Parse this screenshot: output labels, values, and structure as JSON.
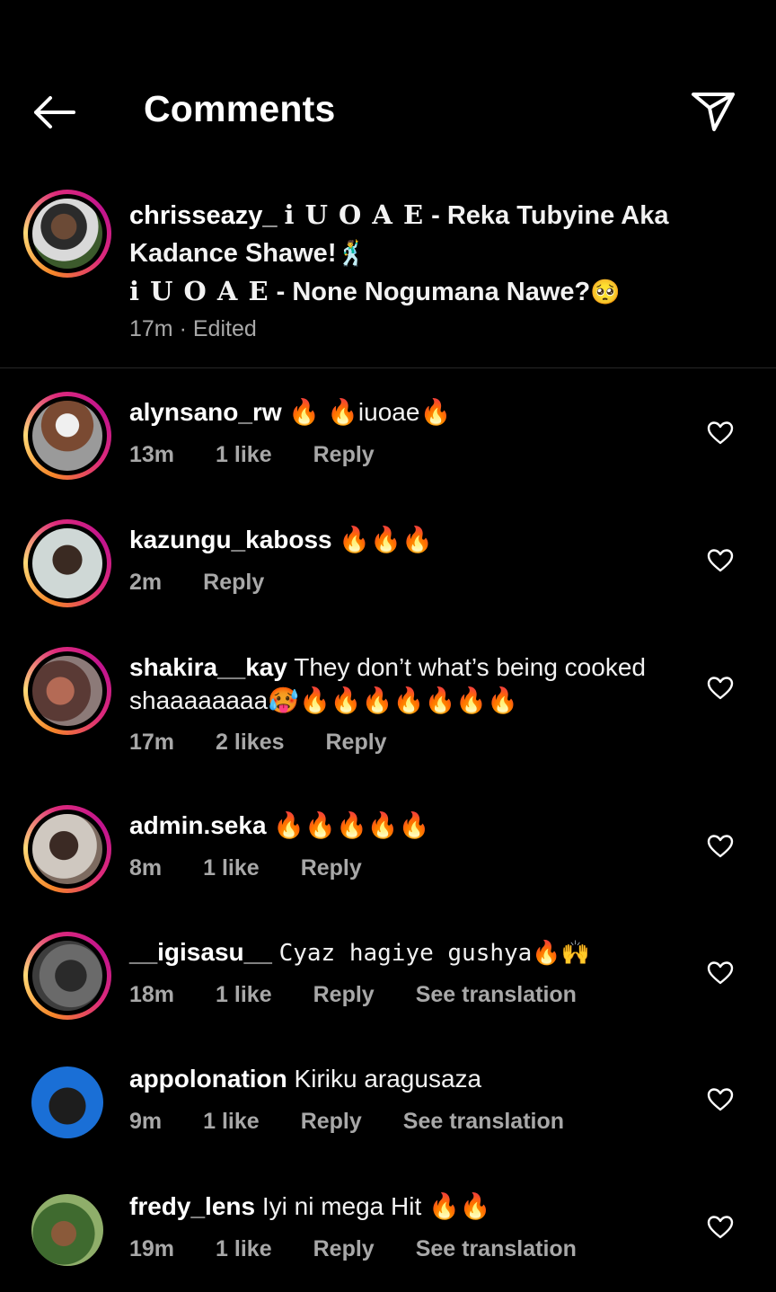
{
  "header": {
    "title": "Comments"
  },
  "caption": {
    "username": "chrisseazy_",
    "line1_styled": "i U O A E",
    "line1_rest": " - Reka Tubyine Aka Kadance Shawe!",
    "line1_emoji": "🕺",
    "line2_styled": "i U O A E",
    "line2_rest": " - None Nogumana Nawe?",
    "line2_emoji": "🥺",
    "time": "17m",
    "sep": " · ",
    "edited": "Edited"
  },
  "comments": [
    {
      "username": "alynsano_rw",
      "text": "🔥 🔥iuoae🔥",
      "time": "13m",
      "likes": "1 like",
      "reply": "Reply",
      "translate": ""
    },
    {
      "username": "kazungu_kaboss",
      "text": "🔥🔥🔥",
      "time": "2m",
      "likes": "",
      "reply": "Reply",
      "translate": ""
    },
    {
      "username": "shakira__kay",
      "text": "They don’t what’s being cooked shaaaaaaaa🥵🔥🔥🔥🔥🔥🔥🔥",
      "time": "17m",
      "likes": "2 likes",
      "reply": "Reply",
      "translate": ""
    },
    {
      "username": "admin.seka",
      "text": "🔥🔥🔥🔥🔥",
      "time": "8m",
      "likes": "1 like",
      "reply": "Reply",
      "translate": ""
    },
    {
      "username": "__igisasu__",
      "text": "Cyaz hagiye gushya🔥🙌",
      "time": "18m",
      "likes": "1 like",
      "reply": "Reply",
      "translate": "See translation"
    },
    {
      "username": "appolonation",
      "text": "Kiriku aragusaza",
      "time": "9m",
      "likes": "1 like",
      "reply": "Reply",
      "translate": "See translation"
    },
    {
      "username": "fredy_lens",
      "text": "Iyi ni mega Hit 🔥🔥",
      "time": "19m",
      "likes": "1 like",
      "reply": "Reply",
      "translate": "See translation"
    }
  ],
  "icons": {
    "back": "arrow-left-icon",
    "send": "paper-plane-icon",
    "like": "heart-icon"
  },
  "colors": {
    "background": "#000000",
    "meta_text": "#a8a8a8",
    "divider": "#262626",
    "story_ring_start": "#f58529",
    "story_ring_end": "#c1148e"
  }
}
